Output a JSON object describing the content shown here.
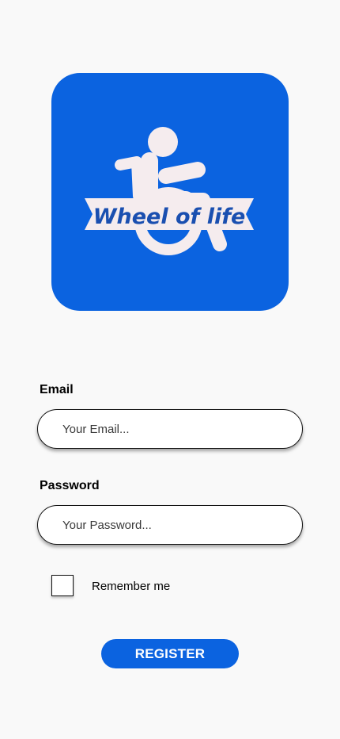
{
  "logo": {
    "text": "Wheel of life",
    "tile_color": "#0b63e0",
    "art_color": "#f5ecee",
    "icon": "wheelchair-icon"
  },
  "form": {
    "email_label": "Email",
    "email_placeholder": "Your Email...",
    "email_value": "",
    "password_label": "Password",
    "password_placeholder": "Your Password...",
    "password_value": "",
    "remember_label": "Remember me",
    "remember_checked": false,
    "register_label": "REGISTER"
  }
}
